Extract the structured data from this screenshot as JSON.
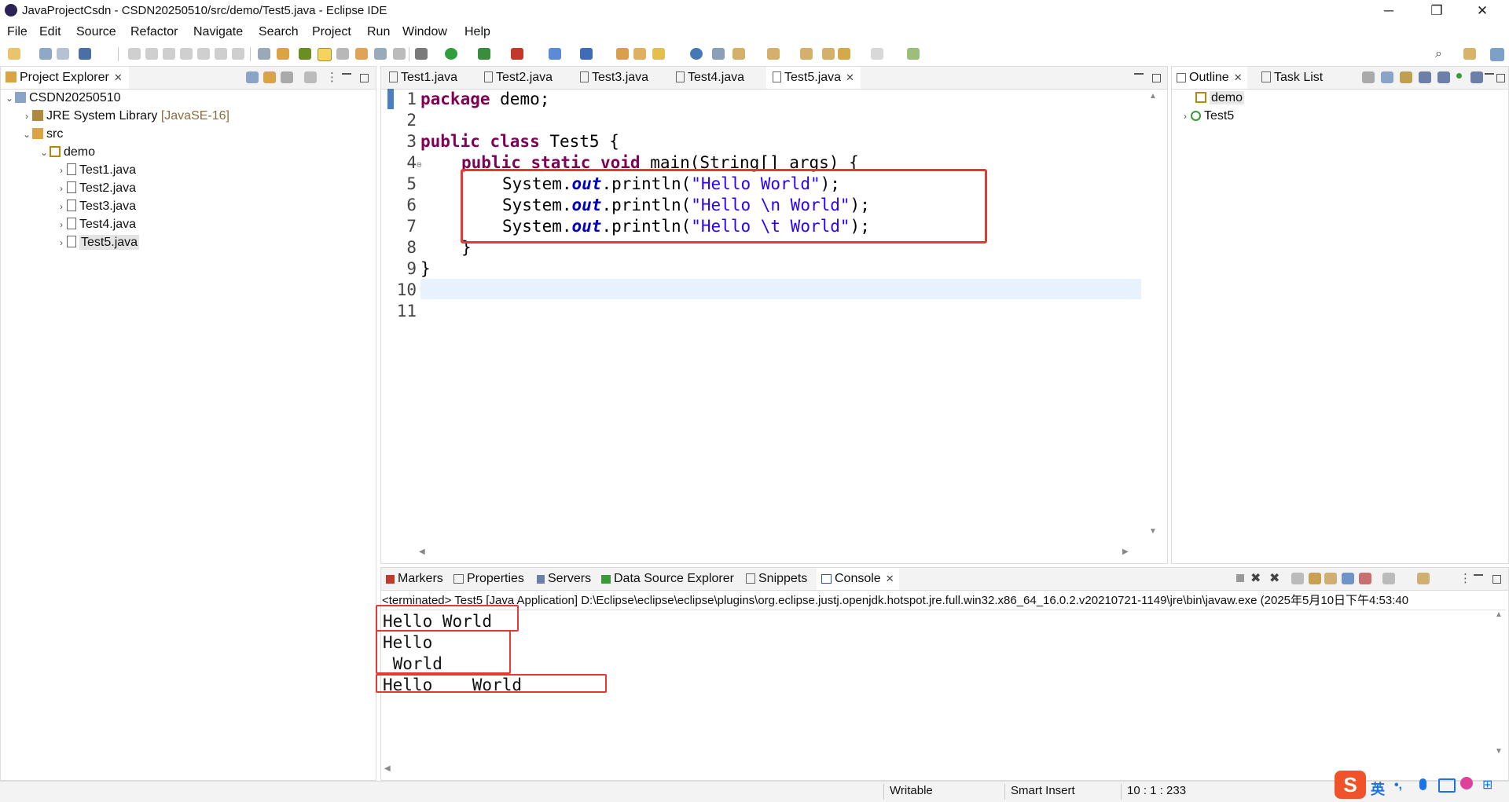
{
  "window": {
    "title": "JavaProjectCsdn - CSDN20250510/src/demo/Test5.java - Eclipse IDE",
    "minimize": "─",
    "restore": "❐",
    "close": "✕"
  },
  "menu": [
    "File",
    "Edit",
    "Source",
    "Refactor",
    "Navigate",
    "Search",
    "Project",
    "Run",
    "Window",
    "Help"
  ],
  "project_explorer": {
    "title": "Project Explorer",
    "project": "CSDN20250510",
    "jre": "JRE System Library",
    "jre_version": "[JavaSE-16]",
    "src": "src",
    "package": "demo",
    "files": [
      "Test1.java",
      "Test2.java",
      "Test3.java",
      "Test4.java",
      "Test5.java"
    ],
    "selected_file": "Test5.java"
  },
  "editor": {
    "tabs": [
      "Test1.java",
      "Test2.java",
      "Test3.java",
      "Test4.java",
      "Test5.java"
    ],
    "active_tab": "Test5.java",
    "line_numbers": [
      "1",
      "2",
      "3",
      "4",
      "5",
      "6",
      "7",
      "8",
      "9",
      "10",
      "11"
    ],
    "lines": {
      "l1_kw": "package",
      "l1_rest": " demo;",
      "l3_kw": "public class",
      "l3_rest": " Test5 {",
      "l4_kw": "public static void",
      "l4_rest": " main(String[] args) {",
      "l5_a": "System.",
      "l5_out": "out",
      "l5_b": ".println(",
      "l5_str": "\"Hello World\"",
      "l5_c": ");",
      "l6_a": "System.",
      "l6_out": "out",
      "l6_b": ".println(",
      "l6_str": "\"Hello \\n World\"",
      "l6_c": ");",
      "l7_a": "System.",
      "l7_out": "out",
      "l7_b": ".println(",
      "l7_str": "\"Hello \\t World\"",
      "l7_c": ");",
      "l8": "}",
      "l9": "}"
    }
  },
  "outline": {
    "title": "Outline",
    "task_list": "Task List",
    "items": [
      "demo",
      "Test5"
    ]
  },
  "bottom": {
    "tabs": [
      "Markers",
      "Properties",
      "Servers",
      "Data Source Explorer",
      "Snippets",
      "Console"
    ],
    "active_tab": "Console",
    "terminated": "<terminated> Test5 [Java Application] D:\\Eclipse\\eclipse\\eclipse\\plugins\\org.eclipse.justj.openjdk.hotspot.jre.full.win32.x86_64_16.0.2.v20210721-1149\\jre\\bin\\javaw.exe  (2025年5月10日下午4:53:40",
    "output": [
      "Hello World",
      "Hello",
      " World",
      "Hello    World"
    ]
  },
  "statusbar": {
    "writable": "Writable",
    "insert_mode": "Smart Insert",
    "position": "10 : 1 : 233"
  },
  "ime": {
    "lang": "英",
    "punct": "•,"
  },
  "colors": {
    "keyword": "#7f0055",
    "field": "#0000c0",
    "string": "#2a00ff",
    "highlight_box": "#e53935",
    "current_line": "#e8f2fe"
  }
}
